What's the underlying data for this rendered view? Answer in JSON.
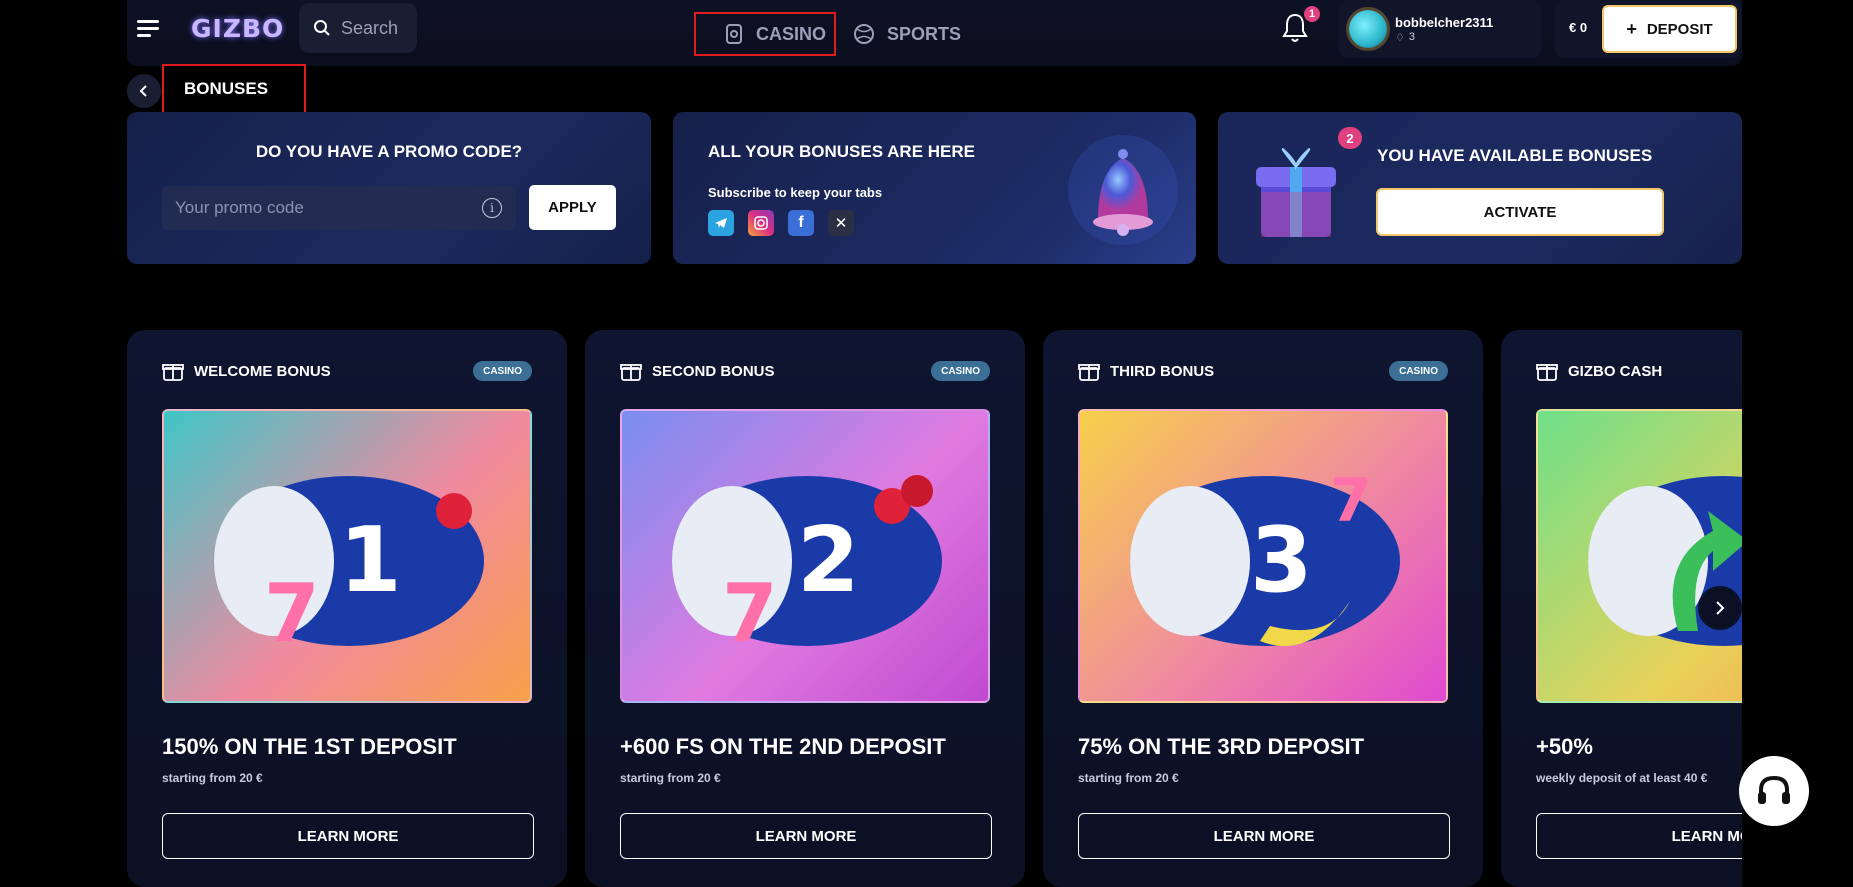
{
  "header": {
    "logo": "GIZBO",
    "search_placeholder": "Search",
    "tabs": [
      {
        "label": "CASINO",
        "active": true
      },
      {
        "label": "SPORTS",
        "active": false
      }
    ],
    "notifications_count": "1",
    "user": {
      "name": "bobbelcher2311",
      "level": "3"
    },
    "balance": "€ 0",
    "deposit_label": "DEPOSIT"
  },
  "page": {
    "title": "BONUSES"
  },
  "promo": {
    "heading": "DO YOU HAVE A PROMO CODE?",
    "placeholder": "Your promo code",
    "apply_label": "APPLY"
  },
  "social": {
    "heading": "ALL YOUR BONUSES ARE HERE",
    "subtitle": "Subscribe to keep your tabs",
    "icons": [
      "telegram-icon",
      "instagram-icon",
      "facebook-icon",
      "x-icon"
    ]
  },
  "available": {
    "heading": "YOU HAVE AVAILABLE BONUSES",
    "count": "2",
    "activate_label": "ACTIVATE"
  },
  "bonuses": [
    {
      "label": "WELCOME BONUS",
      "tag": "CASINO",
      "title": "150% ON THE 1ST DEPOSIT",
      "subtitle": "starting from 20 €",
      "cta": "LEARN MORE",
      "num": "1"
    },
    {
      "label": "SECOND BONUS",
      "tag": "CASINO",
      "title": "+600 FS ON THE 2ND DEPOSIT",
      "subtitle": "starting from 20 €",
      "cta": "LEARN MORE",
      "num": "2"
    },
    {
      "label": "THIRD BONUS",
      "tag": "CASINO",
      "title": "75% ON THE 3RD DEPOSIT",
      "subtitle": "starting from 20 €",
      "cta": "LEARN MORE",
      "num": "3"
    },
    {
      "label": "GIZBO CASH",
      "tag": "",
      "title": "+50%",
      "subtitle": "weekly deposit of at least 40 €",
      "cta": "LEARN MORE",
      "num": ""
    }
  ],
  "colors": {
    "accent_pink": "#e0417e",
    "highlight_red": "#e01b1b",
    "gold_border": "#f0c86a",
    "tag_blue": "#3b6f96"
  }
}
